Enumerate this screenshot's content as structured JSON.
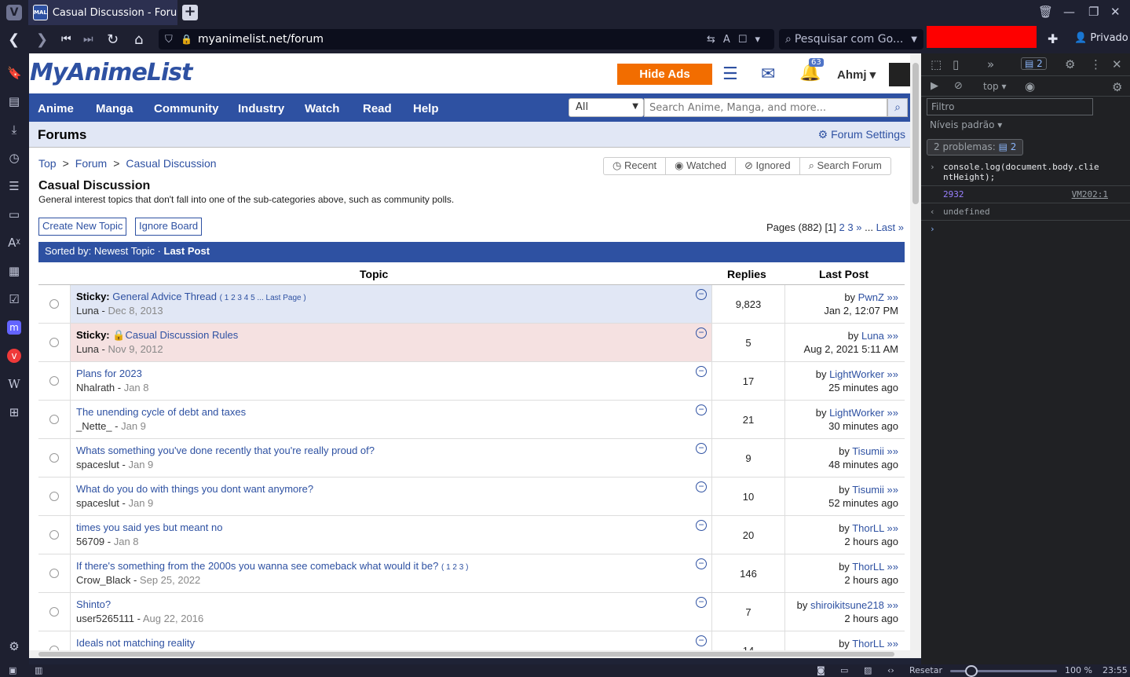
{
  "browser": {
    "tab_title": "Casual Discussion - Forums",
    "tab_favicon": "MAL",
    "url": "myanimelist.net/forum",
    "search_placeholder": "Pesquisar com Go...",
    "private_label": "Privado"
  },
  "site": {
    "logo": "MyAnimeList",
    "hide_ads": "Hide Ads",
    "notification_count": "63",
    "username": "Ahmj",
    "nav": [
      "Anime",
      "Manga",
      "Community",
      "Industry",
      "Watch",
      "Read",
      "Help"
    ],
    "search_category": "All",
    "search_placeholder": "Search Anime, Manga, and more..."
  },
  "forum": {
    "section_title": "Forums",
    "settings_label": "Forum Settings",
    "breadcrumb": [
      "Top",
      "Forum",
      "Casual Discussion"
    ],
    "breadcrumb_sep": ">",
    "filters": [
      "Recent",
      "Watched",
      "Ignored",
      "Search Forum"
    ],
    "board_name": "Casual Discussion",
    "board_desc": "General interest topics that don't fall into one of the sub-categories above, such as community polls.",
    "create_topic": "Create New Topic",
    "ignore_board": "Ignore Board",
    "pages_prefix": "Pages (882) [1]",
    "pages_links": [
      "2",
      "3",
      "»",
      "...",
      "Last »"
    ],
    "sort_prefix": "Sorted by: Newest Topic ·",
    "sort_current": "Last Post",
    "col_topic": "Topic",
    "col_replies": "Replies",
    "col_lastpost": "Last Post",
    "topics": [
      {
        "prefix": "Sticky:",
        "title": "General Advice Thread",
        "pages": "( 1 2 3 4 5 ... Last Page )",
        "author": "Luna",
        "date": "Dec 8, 2013",
        "replies": "9,823",
        "last_user": "PwnZ",
        "last_time": "Jan 2, 12:07 PM",
        "bg": "#e1e7f5"
      },
      {
        "prefix": "Sticky:",
        "title": "Casual Discussion Rules",
        "pages": "",
        "author": "Luna",
        "date": "Nov 9, 2012",
        "replies": "5",
        "last_user": "Luna",
        "last_time": "Aug 2, 2021 5:11 AM",
        "bg": "#f5e1e1",
        "locked": true
      },
      {
        "prefix": "",
        "title": "Plans for 2023",
        "pages": "",
        "author": "Nhalrath",
        "date": "Jan 8",
        "replies": "17",
        "last_user": "LightWorker",
        "last_time": "25 minutes ago",
        "bg": "#ffffff"
      },
      {
        "prefix": "",
        "title": "The unending cycle of debt and taxes",
        "pages": "",
        "author": "_Nette_",
        "date": "Jan 9",
        "replies": "21",
        "last_user": "LightWorker",
        "last_time": "30 minutes ago",
        "bg": "#ffffff"
      },
      {
        "prefix": "",
        "title": "Whats something you've done recently that you're really proud of?",
        "pages": "",
        "author": "spaceslut",
        "date": "Jan 9",
        "replies": "9",
        "last_user": "Tisumii",
        "last_time": "48 minutes ago",
        "bg": "#ffffff"
      },
      {
        "prefix": "",
        "title": "What do you do with things you dont want anymore?",
        "pages": "",
        "author": "spaceslut",
        "date": "Jan 9",
        "replies": "10",
        "last_user": "Tisumii",
        "last_time": "52 minutes ago",
        "bg": "#ffffff"
      },
      {
        "prefix": "",
        "title": "times you said yes but meant no",
        "pages": "",
        "author": "56709",
        "date": "Jan 8",
        "replies": "20",
        "last_user": "ThorLL",
        "last_time": "2 hours ago",
        "bg": "#ffffff"
      },
      {
        "prefix": "",
        "title": "If there's something from the 2000s you wanna see comeback what would it be?",
        "pages": "( 1 2 3 )",
        "author": "Crow_Black",
        "date": "Sep 25, 2022",
        "replies": "146",
        "last_user": "ThorLL",
        "last_time": "2 hours ago",
        "bg": "#ffffff"
      },
      {
        "prefix": "",
        "title": "Shinto?",
        "pages": "",
        "author": "user5265111",
        "date": "Aug 22, 2016",
        "replies": "7",
        "last_user": "shiroikitsune218",
        "last_time": "2 hours ago",
        "bg": "#ffffff"
      },
      {
        "prefix": "",
        "title": "Ideals not matching reality",
        "pages": "",
        "author": "",
        "date": "",
        "replies": "14",
        "last_user": "ThorLL",
        "last_time": "",
        "bg": "#ffffff"
      }
    ]
  },
  "devtools": {
    "context": "top",
    "issues_badge": "2",
    "filter_placeholder": "Filtro",
    "levels": "Níveis padrão ▾",
    "problems_label": "2 problemas:",
    "problems_count": "2",
    "cmd_line1": "console.log(document.body.clie",
    "cmd_line2": "ntHeight);",
    "output_value": "2932",
    "output_source": "VM202:1",
    "return_value": "undefined"
  },
  "statusbar": {
    "reset": "Resetar",
    "zoom": "100 %",
    "time": "23:55"
  }
}
